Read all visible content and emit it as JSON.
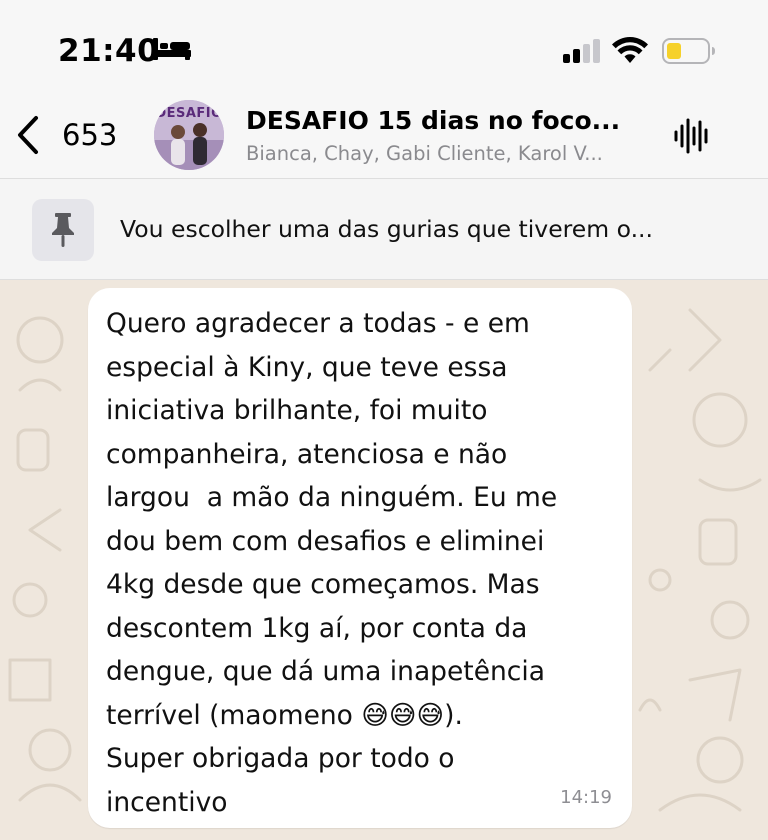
{
  "status_bar": {
    "time": "21:40",
    "focus_icon": "bed-icon",
    "signal_icon": "cellular-signal-icon",
    "wifi_icon": "wifi-icon",
    "battery_icon": "battery-low-icon",
    "battery_color": "#f6d12a"
  },
  "header": {
    "back_count": "653",
    "avatar_label": "DESAFIO",
    "title": "DESAFIO 15 dias no foco...",
    "subtitle": "Bianca, Chay, Gabi Cliente, Karol V...",
    "voice_icon": "voice-chat-icon"
  },
  "pinned": {
    "icon": "pin-icon",
    "text": "Vou escolher uma das gurias que tiverem o..."
  },
  "message": {
    "text": "Quero agradecer a todas - e em\nespecial à Kiny, que teve essa\niniciativa brilhante, foi muito\ncompanheira, atenciosa e não\nlargou  a mão da ninguém. Eu me\ndou bem com desafios e eliminei\n4kg desde que começamos. Mas\ndescontem 1kg aí, por conta da\ndengue, que dá uma inapetência\nterrível (maomeno 😅😅😅).\nSuper obrigada por todo o\nincentivo",
    "time": "14:19"
  },
  "colors": {
    "chat_background": "#efe7dd",
    "bubble": "#ffffff",
    "secondary_text": "#8a8a8e"
  }
}
